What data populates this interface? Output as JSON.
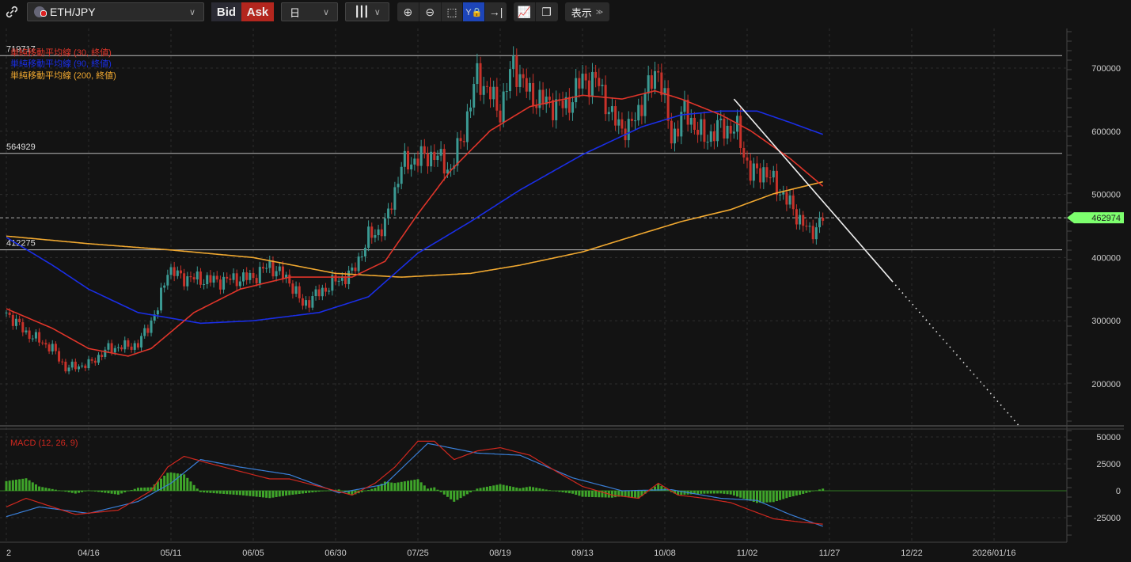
{
  "toolbar": {
    "link_icon": "link-icon",
    "symbol": "ETH/JPY",
    "bid_label": "Bid",
    "ask_label": "Ask",
    "timeframe": "日",
    "chart_type_icon": "candlestick-icon",
    "tools": [
      "zoom-in-icon",
      "zoom-out-icon",
      "fit-icon",
      "y-lock-icon",
      "scroll-to-end-icon"
    ],
    "tools2": [
      "add-indicator-icon",
      "chart-window-icon"
    ],
    "display_label": "表示"
  },
  "colors": {
    "up": "#3b9a93",
    "down": "#c8322a",
    "ma30": "#e0352a",
    "ma90": "#1a2ee6",
    "ma200": "#f0a830",
    "macd": "#d0281f",
    "signal": "#3a7fd8",
    "hist": "#3fa52a",
    "current": "#7dff6e",
    "ask": "#b3261e",
    "bid": "#2a2a33"
  },
  "legend": {
    "ma30": "単純移動平均線 (30, 終値)",
    "ma90": "単純移動平均線 (90, 終値)",
    "ma200": "単純移動平均線 (200, 終値)",
    "macd": "MACD (12, 26, 9)"
  },
  "chart_data": {
    "type": "candlestick",
    "start_date": "2025-03-22",
    "y_ticks": [
      "700000",
      "600000",
      "500000",
      "400000",
      "300000",
      "200000"
    ],
    "macd_ticks": [
      "50000",
      "25000",
      "0",
      "-25000"
    ],
    "x_ticks": [
      {
        "date": "2025-03-22",
        "label": "2"
      },
      {
        "date": "2025-04-16",
        "label": "04/16"
      },
      {
        "date": "2025-05-11",
        "label": "05/11"
      },
      {
        "date": "2025-06-05",
        "label": "06/05"
      },
      {
        "date": "2025-06-30",
        "label": "06/30"
      },
      {
        "date": "2025-07-25",
        "label": "07/25"
      },
      {
        "date": "2025-08-19",
        "label": "08/19"
      },
      {
        "date": "2025-09-13",
        "label": "09/13"
      },
      {
        "date": "2025-10-08",
        "label": "10/08"
      },
      {
        "date": "2025-11-02",
        "label": "11/02"
      },
      {
        "date": "2025-11-27",
        "label": "11/27"
      },
      {
        "date": "2025-12-22",
        "label": "12/22"
      },
      {
        "date": "2026-01-16",
        "label": "2026/01/16"
      }
    ],
    "levels": [
      {
        "value": 719717,
        "label": "719717"
      },
      {
        "value": 564929,
        "label": "564929"
      },
      {
        "value": 412275,
        "label": "412275"
      }
    ],
    "current_price": {
      "value": 462974,
      "label": "462974"
    },
    "trendline": {
      "start": [
        "2025-10-29",
        651000
      ],
      "end": [
        "2025-12-16",
        363000
      ],
      "extend_to": [
        "2026-01-24",
        130000
      ]
    },
    "close_keypoints": [
      [
        "2025-03-22",
        313000
      ],
      [
        "2025-03-28",
        281000
      ],
      [
        "2025-04-05",
        256000
      ],
      [
        "2025-04-09",
        225000
      ],
      [
        "2025-04-16",
        231000
      ],
      [
        "2025-04-22",
        256000
      ],
      [
        "2025-05-01",
        262000
      ],
      [
        "2025-05-07",
        319000
      ],
      [
        "2025-05-10",
        382000
      ],
      [
        "2025-05-14",
        369000
      ],
      [
        "2025-05-25",
        363000
      ],
      [
        "2025-06-05",
        369000
      ],
      [
        "2025-06-10",
        388000
      ],
      [
        "2025-06-16",
        363000
      ],
      [
        "2025-06-20",
        325000
      ],
      [
        "2025-06-30",
        363000
      ],
      [
        "2025-07-05",
        375000
      ],
      [
        "2025-07-10",
        432000
      ],
      [
        "2025-07-15",
        450000
      ],
      [
        "2025-07-20",
        545000
      ],
      [
        "2025-07-25",
        557000
      ],
      [
        "2025-07-30",
        563000
      ],
      [
        "2025-08-04",
        538000
      ],
      [
        "2025-08-08",
        601000
      ],
      [
        "2025-08-12",
        689000
      ],
      [
        "2025-08-16",
        657000
      ],
      [
        "2025-08-19",
        632000
      ],
      [
        "2025-08-23",
        707000
      ],
      [
        "2025-08-28",
        657000
      ],
      [
        "2025-09-02",
        645000
      ],
      [
        "2025-09-08",
        639000
      ],
      [
        "2025-09-13",
        682000
      ],
      [
        "2025-09-18",
        676000
      ],
      [
        "2025-09-22",
        620000
      ],
      [
        "2025-09-27",
        601000
      ],
      [
        "2025-10-01",
        645000
      ],
      [
        "2025-10-06",
        701000
      ],
      [
        "2025-10-10",
        588000
      ],
      [
        "2025-10-14",
        632000
      ],
      [
        "2025-10-20",
        588000
      ],
      [
        "2025-10-25",
        607000
      ],
      [
        "2025-10-30",
        601000
      ],
      [
        "2025-11-03",
        532000
      ],
      [
        "2025-11-07",
        538000
      ],
      [
        "2025-11-11",
        513000
      ],
      [
        "2025-11-16",
        476000
      ],
      [
        "2025-11-21",
        438000
      ],
      [
        "2025-11-25",
        463000
      ]
    ],
    "ma30": [
      [
        "2025-03-22",
        319000
      ],
      [
        "2025-04-05",
        288000
      ],
      [
        "2025-04-16",
        256000
      ],
      [
        "2025-04-28",
        244000
      ],
      [
        "2025-05-05",
        256000
      ],
      [
        "2025-05-18",
        313000
      ],
      [
        "2025-06-01",
        350000
      ],
      [
        "2025-06-16",
        369000
      ],
      [
        "2025-07-05",
        369000
      ],
      [
        "2025-07-15",
        394000
      ],
      [
        "2025-07-25",
        469000
      ],
      [
        "2025-08-04",
        538000
      ],
      [
        "2025-08-16",
        601000
      ],
      [
        "2025-08-28",
        639000
      ],
      [
        "2025-09-13",
        657000
      ],
      [
        "2025-09-25",
        651000
      ],
      [
        "2025-10-05",
        664000
      ],
      [
        "2025-10-13",
        651000
      ],
      [
        "2025-10-25",
        626000
      ],
      [
        "2025-11-03",
        601000
      ],
      [
        "2025-11-15",
        557000
      ],
      [
        "2025-11-25",
        513000
      ]
    ],
    "ma90": [
      [
        "2025-03-22",
        432000
      ],
      [
        "2025-04-05",
        388000
      ],
      [
        "2025-04-16",
        350000
      ],
      [
        "2025-05-01",
        313000
      ],
      [
        "2025-05-20",
        296000
      ],
      [
        "2025-06-05",
        300000
      ],
      [
        "2025-06-25",
        313000
      ],
      [
        "2025-07-10",
        338000
      ],
      [
        "2025-07-25",
        407000
      ],
      [
        "2025-08-10",
        457000
      ],
      [
        "2025-08-25",
        507000
      ],
      [
        "2025-09-13",
        563000
      ],
      [
        "2025-10-01",
        607000
      ],
      [
        "2025-10-13",
        626000
      ],
      [
        "2025-10-25",
        632000
      ],
      [
        "2025-11-05",
        632000
      ],
      [
        "2025-11-15",
        614000
      ],
      [
        "2025-11-25",
        595000
      ]
    ],
    "ma200": [
      [
        "2025-03-22",
        434000
      ],
      [
        "2025-04-16",
        422000
      ],
      [
        "2025-05-11",
        412000
      ],
      [
        "2025-06-05",
        400000
      ],
      [
        "2025-06-30",
        375000
      ],
      [
        "2025-07-20",
        369000
      ],
      [
        "2025-08-10",
        375000
      ],
      [
        "2025-08-25",
        388000
      ],
      [
        "2025-09-13",
        409000
      ],
      [
        "2025-10-01",
        438000
      ],
      [
        "2025-10-13",
        457000
      ],
      [
        "2025-10-28",
        476000
      ],
      [
        "2025-11-10",
        501000
      ],
      [
        "2025-11-25",
        520000
      ]
    ],
    "macd_line": [
      [
        "2025-03-22",
        -15000
      ],
      [
        "2025-03-28",
        -7000
      ],
      [
        "2025-04-05",
        -15000
      ],
      [
        "2025-04-12",
        -22000
      ],
      [
        "2025-04-25",
        -18000
      ],
      [
        "2025-05-05",
        0
      ],
      [
        "2025-05-10",
        22000
      ],
      [
        "2025-05-15",
        32000
      ],
      [
        "2025-05-22",
        26000
      ],
      [
        "2025-06-01",
        18000
      ],
      [
        "2025-06-10",
        11000
      ],
      [
        "2025-06-16",
        11000
      ],
      [
        "2025-06-25",
        4000
      ],
      [
        "2025-07-05",
        -4000
      ],
      [
        "2025-07-12",
        7000
      ],
      [
        "2025-07-18",
        22000
      ],
      [
        "2025-07-25",
        46000
      ],
      [
        "2025-07-30",
        46000
      ],
      [
        "2025-08-05",
        29000
      ],
      [
        "2025-08-12",
        37000
      ],
      [
        "2025-08-19",
        40000
      ],
      [
        "2025-08-28",
        33000
      ],
      [
        "2025-09-05",
        18000
      ],
      [
        "2025-09-13",
        4000
      ],
      [
        "2025-09-22",
        -4000
      ],
      [
        "2025-09-30",
        -7000
      ],
      [
        "2025-10-06",
        7000
      ],
      [
        "2025-10-12",
        -4000
      ],
      [
        "2025-10-20",
        -7000
      ],
      [
        "2025-10-28",
        -11000
      ],
      [
        "2025-11-03",
        -18000
      ],
      [
        "2025-11-10",
        -26000
      ],
      [
        "2025-11-18",
        -29000
      ],
      [
        "2025-11-25",
        -31000
      ]
    ],
    "signal_line": [
      [
        "2025-03-22",
        -24000
      ],
      [
        "2025-04-01",
        -15000
      ],
      [
        "2025-04-16",
        -21000
      ],
      [
        "2025-05-01",
        -10000
      ],
      [
        "2025-05-11",
        7000
      ],
      [
        "2025-05-20",
        29000
      ],
      [
        "2025-06-01",
        22000
      ],
      [
        "2025-06-16",
        15000
      ],
      [
        "2025-07-01",
        -2000
      ],
      [
        "2025-07-15",
        6000
      ],
      [
        "2025-07-28",
        44000
      ],
      [
        "2025-08-12",
        35000
      ],
      [
        "2025-08-25",
        33000
      ],
      [
        "2025-09-10",
        12000
      ],
      [
        "2025-09-25",
        0
      ],
      [
        "2025-10-10",
        1000
      ],
      [
        "2025-10-25",
        -7000
      ],
      [
        "2025-11-05",
        -9000
      ],
      [
        "2025-11-15",
        -22000
      ],
      [
        "2025-11-25",
        -33000
      ]
    ]
  }
}
